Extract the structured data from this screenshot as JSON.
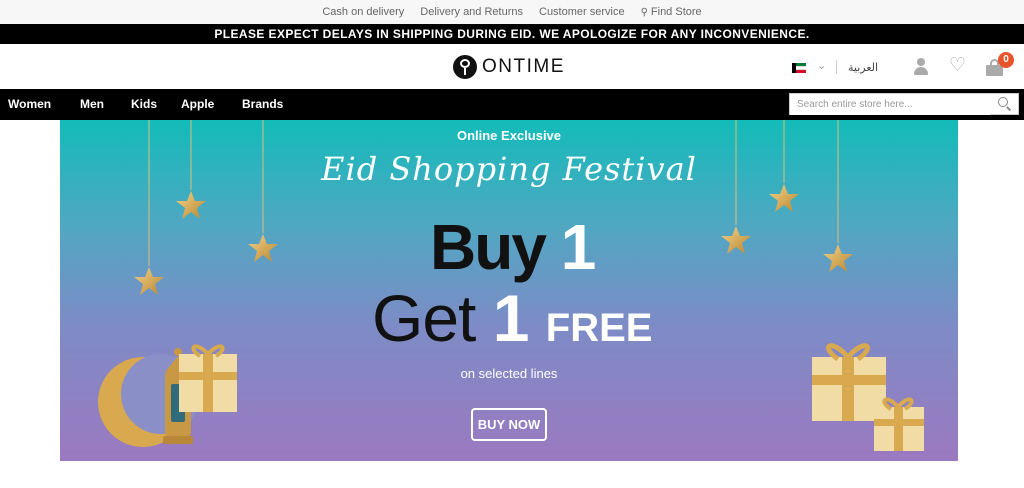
{
  "utility_bar": {
    "links": [
      "Cash on delivery",
      "Delivery and Returns",
      "Customer service",
      "Find Store"
    ]
  },
  "announcement": "PLEASE EXPECT DELAYS IN SHIPPING DURING EID. WE APOLOGIZE FOR ANY INCONVENIENCE.",
  "header": {
    "logo_text": "ONTIME",
    "language_label": "العربية",
    "cart_count": "0",
    "country_flag": "kuwait-flag-icon",
    "icons": [
      "user-icon",
      "heart-icon",
      "cart-icon"
    ]
  },
  "nav": {
    "items": [
      "Women",
      "Men",
      "Kids",
      "Apple",
      "Brands"
    ],
    "search_placeholder": "Search entire store here..."
  },
  "banner": {
    "kicker": "Online Exclusive",
    "title": "Eid Shopping Festival",
    "buy_word": "Buy",
    "buy_number": "1",
    "get_word": "Get",
    "get_number": "1",
    "free_word": "FREE",
    "subtitle": "on selected lines",
    "cta": "BUY NOW",
    "colors": {
      "gradient_top": "#13bbb9",
      "gradient_bottom": "#9b79c0",
      "gold": "#d6a84a"
    }
  },
  "colors": {
    "accent": "#e8532a",
    "nav_bg": "#000000"
  }
}
